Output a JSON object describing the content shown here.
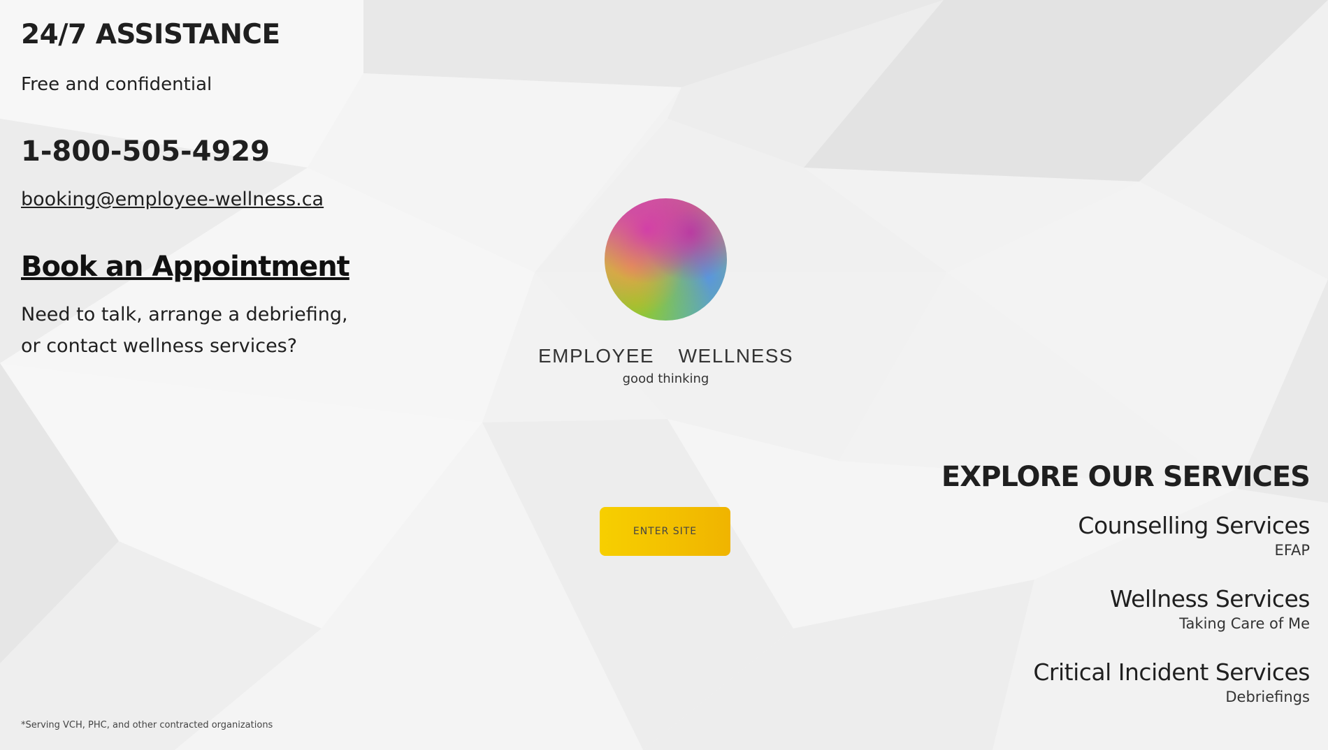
{
  "contact": {
    "heading": "24/7 ASSISTANCE",
    "subheading": "Free and confidential",
    "phone": "1-800-505-4929",
    "email": "booking@employee-wellness.ca"
  },
  "appointment": {
    "link_label": "Book an Appointment",
    "line1": "Need to talk, arrange a debriefing,",
    "line2": "or contact wellness services?"
  },
  "brand": {
    "name": "EMPLOYEE  WELLNESS",
    "tagline": "good thinking"
  },
  "enter_button": {
    "label": "ENTER SITE",
    "color": "#f5c400"
  },
  "services": {
    "heading": "EXPLORE OUR SERVICES",
    "items": [
      {
        "title": "Counselling Services",
        "subtitle": "EFAP"
      },
      {
        "title": "Wellness Services",
        "subtitle": "Taking Care of Me"
      },
      {
        "title": "Critical Incident Services",
        "subtitle": "Debriefings"
      }
    ]
  },
  "footnote": "*Serving VCH, PHC, and other contracted organizations"
}
